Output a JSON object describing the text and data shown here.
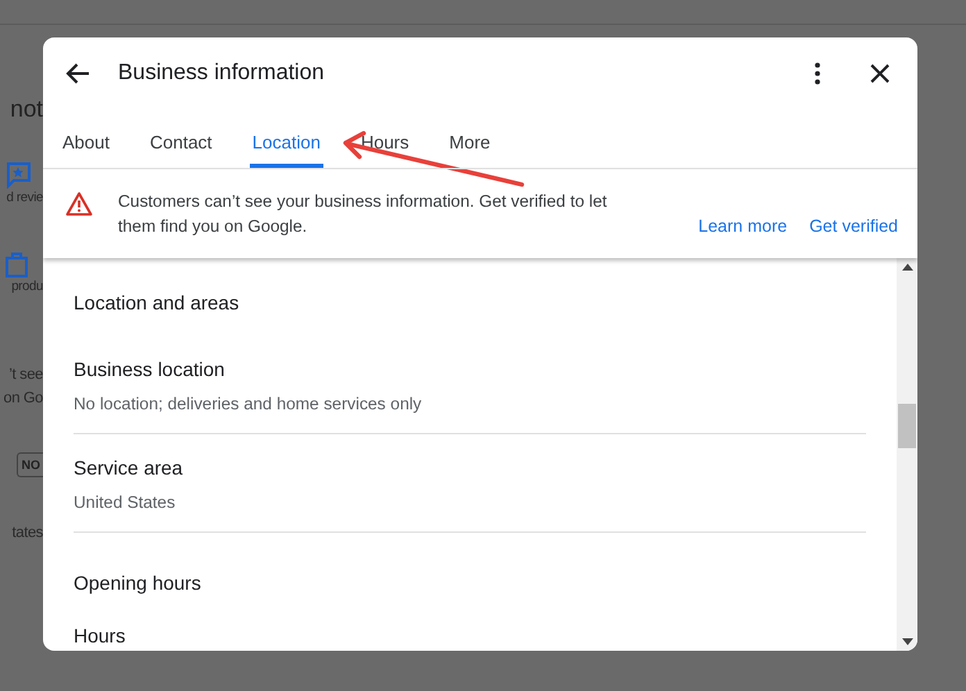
{
  "background": {
    "heading": "not",
    "items": [
      {
        "kind": "review",
        "lines": [
          "d revie"
        ]
      },
      {
        "kind": "product",
        "lines": [
          "produ"
        ]
      },
      {
        "kind": "notice",
        "lines": [
          "’t see",
          "on Go"
        ]
      },
      {
        "kind": "badge",
        "lines": [
          "NO"
        ]
      },
      {
        "kind": "plain",
        "lines": [
          "tates"
        ]
      }
    ]
  },
  "dialog": {
    "title": "Business information",
    "tabs": [
      {
        "label": "About",
        "selected": false
      },
      {
        "label": "Contact",
        "selected": false
      },
      {
        "label": "Location",
        "selected": true
      },
      {
        "label": "Hours",
        "selected": false
      },
      {
        "label": "More",
        "selected": false
      }
    ],
    "banner": {
      "message": "Customers can’t see your business information. Get verified to let them find you on Google.",
      "links": [
        "Learn more",
        "Get verified"
      ]
    },
    "sections": [
      {
        "kind": "heading",
        "title": "Location and areas"
      },
      {
        "kind": "field",
        "title": "Business location",
        "value": "No location; deliveries and home services only"
      },
      {
        "kind": "field",
        "title": "Service area",
        "value": "United States"
      },
      {
        "kind": "heading",
        "title": "Opening hours"
      },
      {
        "kind": "label",
        "title": "Hours"
      }
    ]
  }
}
